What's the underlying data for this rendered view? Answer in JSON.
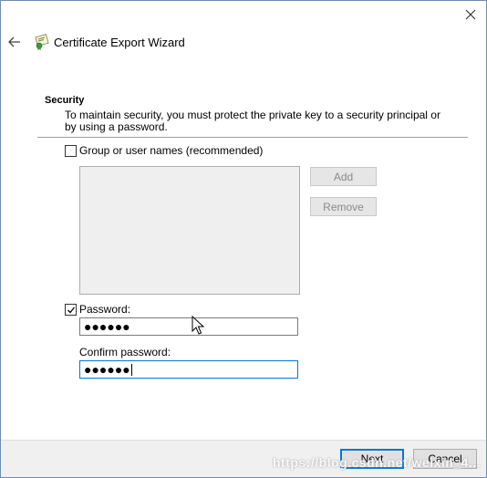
{
  "window": {
    "title": "Certificate Export Wizard"
  },
  "security": {
    "heading": "Security",
    "description": "To maintain security, you must protect the private key to a security principal or by using a password."
  },
  "group_option": {
    "label": "Group or user names (recommended)",
    "checked": false,
    "add_label": "Add",
    "remove_label": "Remove"
  },
  "password_option": {
    "label": "Password:",
    "checked": true,
    "password_mask": "●●●●●●",
    "confirm_label": "Confirm password:",
    "confirm_mask": "●●●●●●"
  },
  "footer": {
    "next_label": "Next",
    "cancel_label": "Cancel"
  },
  "watermark": "https://blog.csdn.net/weixin_4...",
  "icons": [
    "close-icon",
    "back-arrow-icon",
    "certificate-icon",
    "checkmark-icon",
    "mouse-pointer-icon"
  ]
}
